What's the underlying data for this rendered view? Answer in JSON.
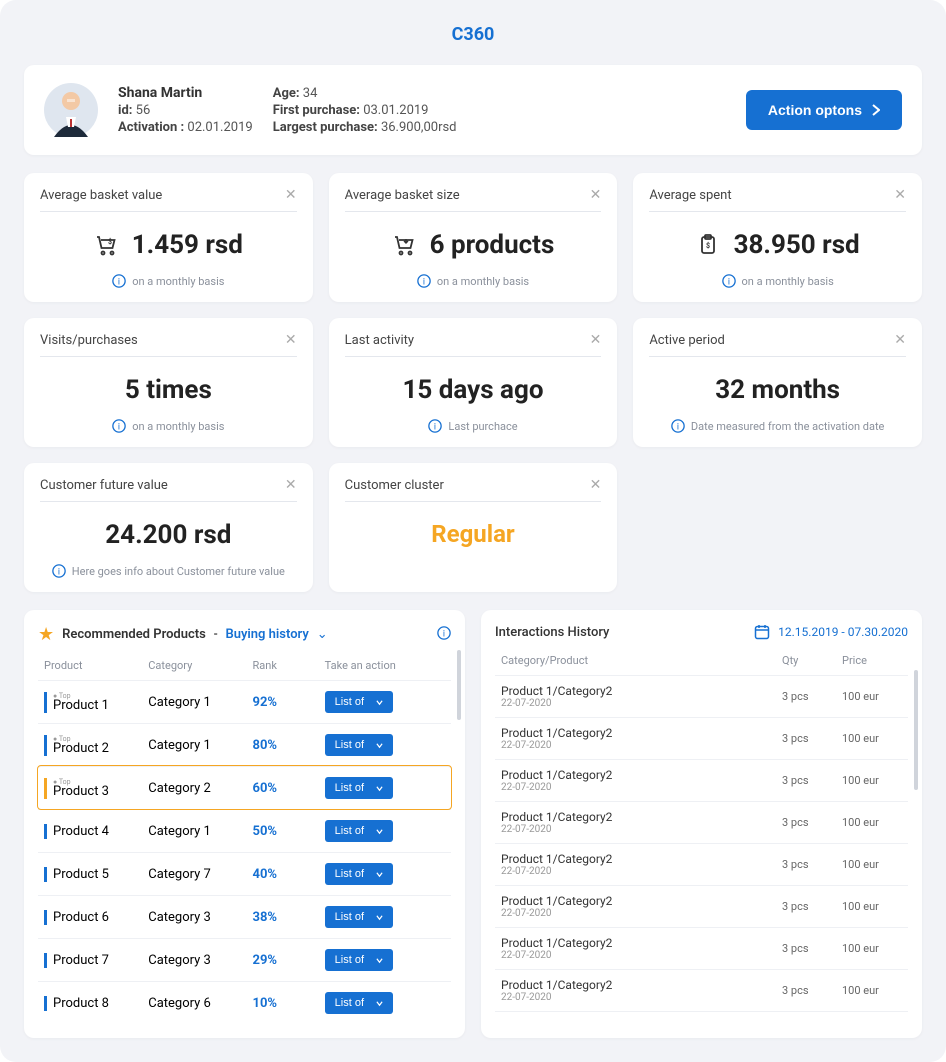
{
  "page": {
    "title": "C360"
  },
  "profile": {
    "name": "Shana Martin",
    "id_label": "id:",
    "id_value": "56",
    "activation_label": "Activation :",
    "activation_value": "02.01.2019",
    "age_label": "Age:",
    "age_value": "34",
    "first_label": "First purchase:",
    "first_value": "03.01.2019",
    "largest_label": "Largest purchase:",
    "largest_value": "36.900,00rsd",
    "action_label": "Action optons"
  },
  "cards": [
    {
      "title": "Average basket value",
      "value": "1.459 rsd",
      "note": "on a monthly basis",
      "icon": "cart-dollar"
    },
    {
      "title": "Average basket size",
      "value": "6 products",
      "note": "on a monthly basis",
      "icon": "cart-down"
    },
    {
      "title": "Average spent",
      "value": "38.950 rsd",
      "note": "on a monthly basis",
      "icon": "clipboard"
    },
    {
      "title": "Visits/purchases",
      "value": "5 times",
      "note": "on a monthly basis",
      "icon": "none"
    },
    {
      "title": "Last activity",
      "value": "15 days ago",
      "note": "Last purchace",
      "icon": "none"
    },
    {
      "title": "Active period",
      "value": "32 months",
      "note": "Date measured from the activation date",
      "icon": "none"
    },
    {
      "title": "Customer future value",
      "value": "24.200 rsd",
      "note": "Here goes info about Customer future value",
      "icon": "none"
    },
    {
      "title": "Customer cluster",
      "value": "Regular",
      "note": "",
      "icon": "none",
      "special": "regular"
    }
  ],
  "recommended": {
    "title_black": "Recommended Products",
    "title_blue": "Buying history",
    "head": {
      "product": "Product",
      "category": "Category",
      "rank": "Rank",
      "action": "Take an action"
    },
    "button_label": "List of",
    "rows": [
      {
        "top": "Top",
        "product": "Product 1",
        "category": "Category 1",
        "rank": "92%"
      },
      {
        "top": "Top",
        "product": "Product 2",
        "category": "Category 1",
        "rank": "80%"
      },
      {
        "top": "Top",
        "product": "Product 3",
        "category": "Category 2",
        "rank": "60%",
        "selected": true
      },
      {
        "top": "",
        "product": "Product 4",
        "category": "Category 1",
        "rank": "50%"
      },
      {
        "top": "",
        "product": "Product 5",
        "category": "Category 7",
        "rank": "40%"
      },
      {
        "top": "",
        "product": "Product 6",
        "category": "Category 3",
        "rank": "38%"
      },
      {
        "top": "",
        "product": "Product 7",
        "category": "Category 3",
        "rank": "29%"
      },
      {
        "top": "",
        "product": "Product 8",
        "category": "Category 6",
        "rank": "10%"
      }
    ]
  },
  "interactions": {
    "title": "Interactions History",
    "daterange": "12.15.2019 - 07.30.2020",
    "head": {
      "cat": "Category/Product",
      "qty": "Qty",
      "price": "Price"
    },
    "rows": [
      {
        "name": "Product 1/Category2",
        "date": "22-07-2020",
        "qty": "3 pcs",
        "price": "100 eur"
      },
      {
        "name": "Product 1/Category2",
        "date": "22-07-2020",
        "qty": "3 pcs",
        "price": "100 eur"
      },
      {
        "name": "Product 1/Category2",
        "date": "22-07-2020",
        "qty": "3 pcs",
        "price": "100 eur"
      },
      {
        "name": "Product 1/Category2",
        "date": "22-07-2020",
        "qty": "3 pcs",
        "price": "100 eur"
      },
      {
        "name": "Product 1/Category2",
        "date": "22-07-2020",
        "qty": "3 pcs",
        "price": "100 eur"
      },
      {
        "name": "Product 1/Category2",
        "date": "22-07-2020",
        "qty": "3 pcs",
        "price": "100 eur"
      },
      {
        "name": "Product 1/Category2",
        "date": "22-07-2020",
        "qty": "3 pcs",
        "price": "100 eur"
      },
      {
        "name": "Product 1/Category2",
        "date": "22-07-2020",
        "qty": "3 pcs",
        "price": "100 eur"
      }
    ]
  }
}
